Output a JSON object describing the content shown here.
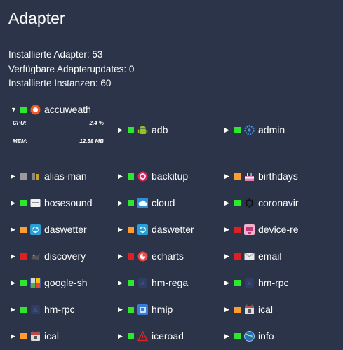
{
  "title": "Adapter",
  "stats": {
    "installed": "Installierte Adapter: 53",
    "updates": "Verfügbare Adapterupdates: 0",
    "instances": "Installierte Instanzen: 60"
  },
  "metrics": {
    "cpu_label": "CPU:",
    "cpu_value": "2.4 %",
    "mem_label": "MEM:",
    "mem_value": "12.58 MB"
  },
  "colors": {
    "green": "#2ee62e",
    "orange": "#ff9d2e",
    "red": "#e02020",
    "gray": "#9a9a9a"
  },
  "adapters": [
    {
      "name": "accuweath",
      "status": "green",
      "icon": "accuweather-icon",
      "expanded": true
    },
    {
      "name": "adb",
      "status": "green",
      "icon": "android-icon"
    },
    {
      "name": "admin",
      "status": "green",
      "icon": "admin-gear-icon"
    },
    {
      "name": "alias-man",
      "status": "gray",
      "icon": "alias-icon"
    },
    {
      "name": "backitup",
      "status": "green",
      "icon": "backitup-icon"
    },
    {
      "name": "birthdays",
      "status": "orange",
      "icon": "cake-icon"
    },
    {
      "name": "bosesound",
      "status": "green",
      "icon": "speaker-icon"
    },
    {
      "name": "cloud",
      "status": "green",
      "icon": "cloud-icon"
    },
    {
      "name": "coronavir",
      "status": "green",
      "icon": "virus-icon"
    },
    {
      "name": "daswetter",
      "status": "orange",
      "icon": "daswetter-icon"
    },
    {
      "name": "daswetter",
      "status": "orange",
      "icon": "daswetter-icon"
    },
    {
      "name": "device-re",
      "status": "red",
      "icon": "device-reminder-icon"
    },
    {
      "name": "discovery",
      "status": "red",
      "icon": "discovery-icon"
    },
    {
      "name": "echarts",
      "status": "red",
      "icon": "echarts-icon"
    },
    {
      "name": "email",
      "status": "red",
      "icon": "email-icon"
    },
    {
      "name": "google-sh",
      "status": "green",
      "icon": "google-sharedlocations-icon"
    },
    {
      "name": "hm-rega",
      "status": "green",
      "icon": "homematic-icon"
    },
    {
      "name": "hm-rpc",
      "status": "green",
      "icon": "homematic-icon"
    },
    {
      "name": "hm-rpc",
      "status": "green",
      "icon": "homematic-icon"
    },
    {
      "name": "hmip",
      "status": "green",
      "icon": "hmip-icon"
    },
    {
      "name": "ical",
      "status": "orange",
      "icon": "calendar-icon"
    },
    {
      "name": "ical",
      "status": "orange",
      "icon": "calendar-icon"
    },
    {
      "name": "iceroad",
      "status": "green",
      "icon": "iceroad-warning-icon"
    },
    {
      "name": "info",
      "status": "green",
      "icon": "info-globe-icon"
    }
  ]
}
